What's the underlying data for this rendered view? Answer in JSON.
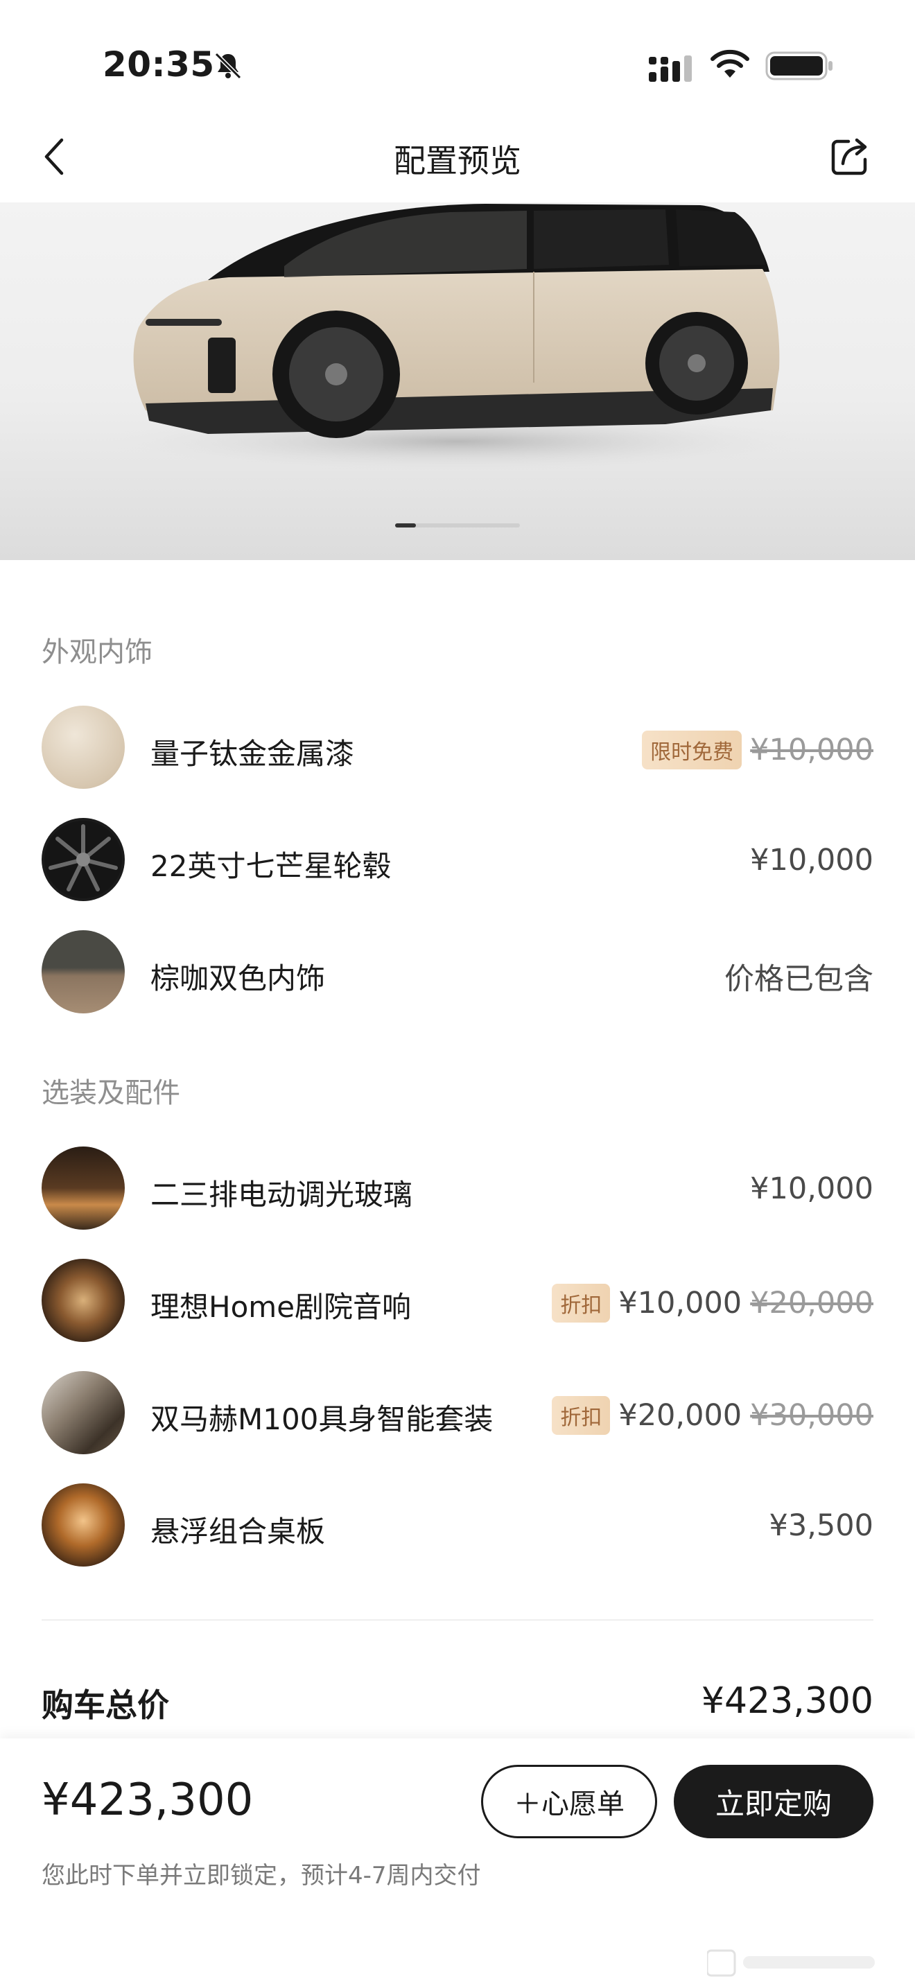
{
  "status_bar": {
    "time": "20:35"
  },
  "nav": {
    "title": "配置预览"
  },
  "sections": {
    "exterior_interior": {
      "title": "外观内饰",
      "items": [
        {
          "label": "量子钛金金属漆",
          "tag": "限时免费",
          "original_price": "¥10,000"
        },
        {
          "label": "22英寸七芒星轮毂",
          "price": "¥10,000"
        },
        {
          "label": "棕咖双色内饰",
          "price": "价格已包含"
        }
      ]
    },
    "options": {
      "title": "选装及配件",
      "items": [
        {
          "label": "二三排电动调光玻璃",
          "price": "¥10,000"
        },
        {
          "label": "理想Home剧院音响",
          "tag": "折扣",
          "price": "¥10,000",
          "original_price": "¥20,000"
        },
        {
          "label": "双马赫M100具身智能套装",
          "tag": "折扣",
          "price": "¥20,000",
          "original_price": "¥30,000"
        },
        {
          "label": "悬浮组合桌板",
          "price": "¥3,500"
        }
      ]
    }
  },
  "total": {
    "label": "购车总价",
    "value": "¥423,300"
  },
  "bottom": {
    "price": "¥423,300",
    "note": "您此时下单并立即锁定，预计4-7周内交付",
    "wishlist_label": "＋心愿单",
    "buy_label": "立即定购"
  },
  "carousel": {
    "current": 1
  },
  "colors": {
    "accent_dark": "#1b1b1b",
    "tag_text": "#a0683a",
    "tag_bg": "#f6e1c7"
  }
}
